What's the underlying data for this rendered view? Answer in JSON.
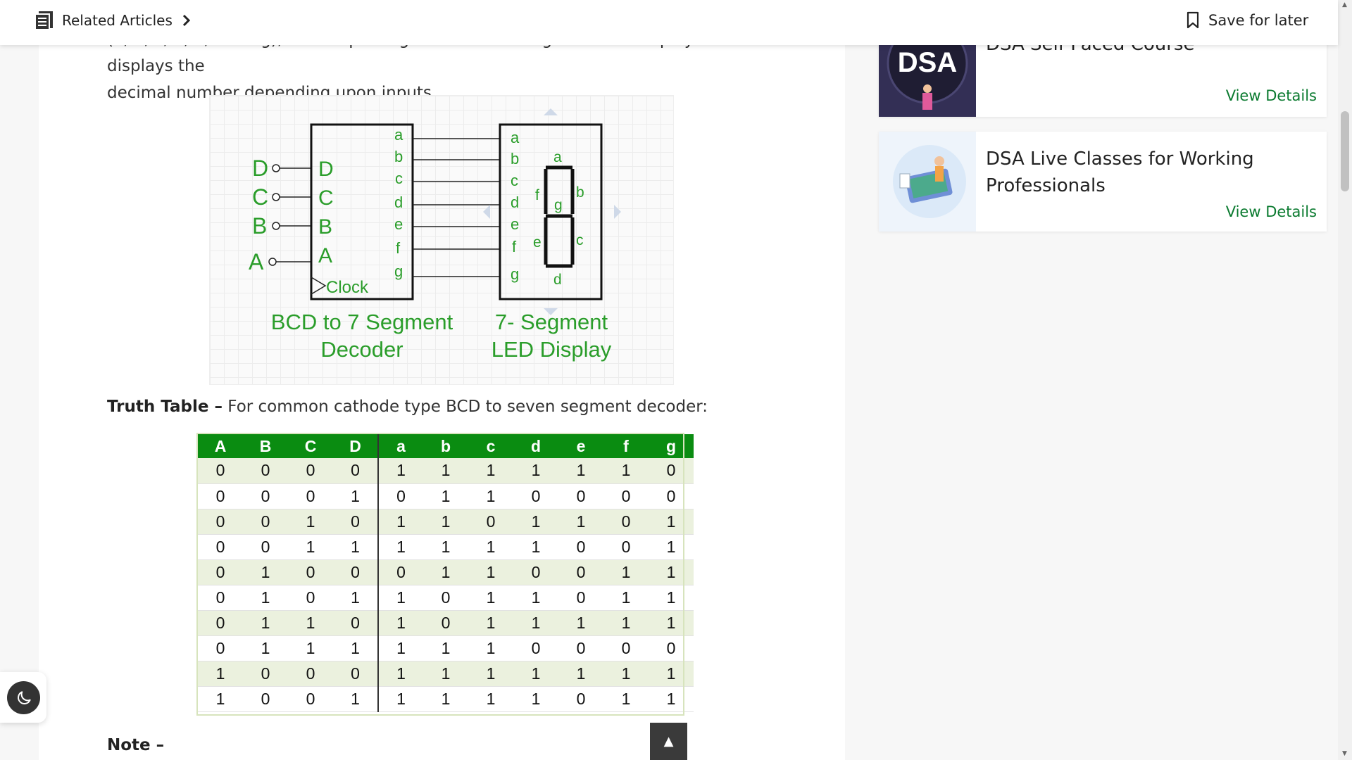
{
  "topbar": {
    "related_label": "Related Articles",
    "save_label": "Save for later"
  },
  "article": {
    "paragraph_line1": "(a, b, c, d, e, f and g), this output is given to seven segment LED display which displays the",
    "paragraph_line2": "decimal number depending upon inputs.",
    "diagram": {
      "inputs": [
        "D",
        "C",
        "B",
        "A"
      ],
      "decoder_pins": [
        "D",
        "C",
        "B",
        "A"
      ],
      "clock_label": "Clock",
      "outputs": [
        "a",
        "b",
        "c",
        "d",
        "e",
        "f",
        "g"
      ],
      "segment_labels": [
        "a",
        "b",
        "c",
        "d",
        "e",
        "f",
        "g"
      ],
      "decoder_caption_1": "BCD to 7 Segment",
      "decoder_caption_2": "Decoder",
      "display_caption_1": "7- Segment",
      "display_caption_2": "LED Display"
    },
    "truth_table_heading": "Truth Table –",
    "truth_table_text": " For common cathode type BCD to seven segment decoder:",
    "table": {
      "headers": [
        "A",
        "B",
        "C",
        "D",
        "a",
        "b",
        "c",
        "d",
        "e",
        "f",
        "g"
      ],
      "rows": [
        [
          "0",
          "0",
          "0",
          "0",
          "1",
          "1",
          "1",
          "1",
          "1",
          "1",
          "0"
        ],
        [
          "0",
          "0",
          "0",
          "1",
          "0",
          "1",
          "1",
          "0",
          "0",
          "0",
          "0"
        ],
        [
          "0",
          "0",
          "1",
          "0",
          "1",
          "1",
          "0",
          "1",
          "1",
          "0",
          "1"
        ],
        [
          "0",
          "0",
          "1",
          "1",
          "1",
          "1",
          "1",
          "1",
          "0",
          "0",
          "1"
        ],
        [
          "0",
          "1",
          "0",
          "0",
          "0",
          "1",
          "1",
          "0",
          "0",
          "1",
          "1"
        ],
        [
          "0",
          "1",
          "0",
          "1",
          "1",
          "0",
          "1",
          "1",
          "0",
          "1",
          "1"
        ],
        [
          "0",
          "1",
          "1",
          "0",
          "1",
          "0",
          "1",
          "1",
          "1",
          "1",
          "1"
        ],
        [
          "0",
          "1",
          "1",
          "1",
          "1",
          "1",
          "1",
          "0",
          "0",
          "0",
          "0"
        ],
        [
          "1",
          "0",
          "0",
          "0",
          "1",
          "1",
          "1",
          "1",
          "1",
          "1",
          "1"
        ],
        [
          "1",
          "0",
          "0",
          "1",
          "1",
          "1",
          "1",
          "1",
          "0",
          "1",
          "1"
        ]
      ]
    },
    "note_label": "Note –",
    "scroll_top_symbol": "▲"
  },
  "sidebar": {
    "cards": [
      {
        "title": "DSA Self Paced Course",
        "thumb_text": "DSA",
        "view_label": "View Details"
      },
      {
        "title_line1": "DSA Live Classes for Working",
        "title_line2": "Professionals",
        "view_label": "View Details"
      }
    ]
  },
  "colors": {
    "accent_green": "#0a7a2f",
    "table_header": "#0a8c11",
    "table_row_alt": "#ebf1de",
    "diagram_green": "#2a9d2a"
  }
}
